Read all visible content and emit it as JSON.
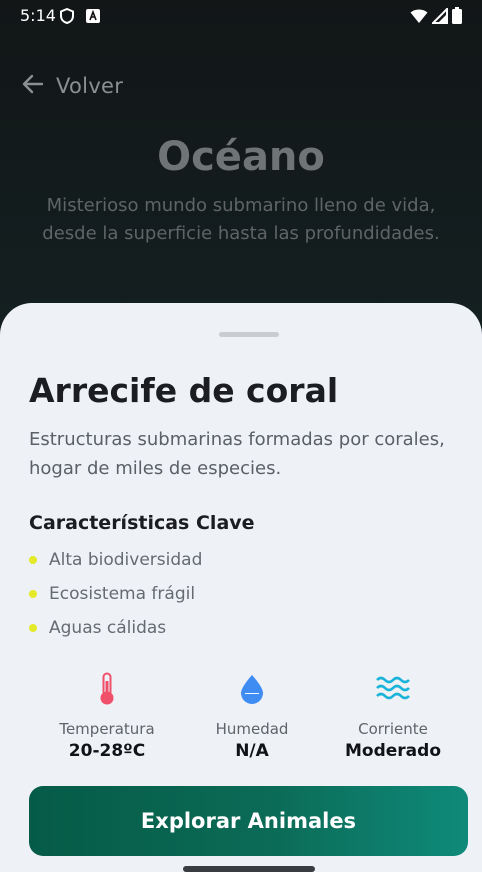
{
  "status_bar": {
    "time": "5:14",
    "icons": [
      "shield-icon",
      "font-a-icon",
      "wifi-icon",
      "signal-icon",
      "battery-icon"
    ]
  },
  "header": {
    "back_label": "Volver",
    "title": "Océano",
    "subtitle": "Misterioso mundo submarino lleno de vida, desde la superficie hasta las profundidades."
  },
  "sheet": {
    "title": "Arrecife de coral",
    "description": "Estructuras submarinas formadas por corales, hogar de miles de especies.",
    "features_title": "Características Clave",
    "features": [
      "Alta biodiversidad",
      "Ecosistema frágil",
      "Aguas cálidas"
    ],
    "bullet_color": "#e4ea28",
    "stats": [
      {
        "label": "Temperatura",
        "value": "20-28ºC",
        "icon": "thermometer-icon",
        "color": "#f0506a"
      },
      {
        "label": "Humedad",
        "value": "N/A",
        "icon": "water-drop-icon",
        "color": "#3f8df2"
      },
      {
        "label": "Corriente",
        "value": "Moderado",
        "icon": "waves-icon",
        "color": "#19b3d9"
      }
    ],
    "cta_label": "Explorar Animales"
  },
  "colors": {
    "accent": "#0b6b56",
    "background": "#121617",
    "sheet": "#eef1f6"
  }
}
